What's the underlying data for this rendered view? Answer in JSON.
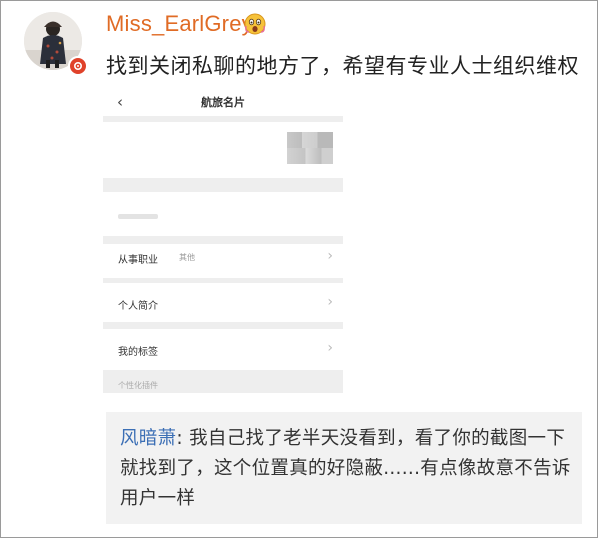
{
  "post": {
    "username": "Miss_EarlGrey",
    "text": "找到关闭私聊的地方了，希望有专业人士组织维权",
    "icons": {
      "emoji": "shocked-emoji-icon",
      "verify": "verified-badge-icon"
    },
    "colors": {
      "username": "#e06b25",
      "badge": "#e0422a"
    }
  },
  "screenshot": {
    "nav_title": "航旅名片",
    "rows": [
      {
        "label": "从事职业",
        "sub": "其他"
      },
      {
        "label": "个人简介",
        "sub": ""
      },
      {
        "label": "我的标签",
        "sub": ""
      }
    ],
    "footer_label": "个性化插件"
  },
  "comment": {
    "author": "风暗萧",
    "separator": ": ",
    "text": "我自己找了老半天没看到，看了你的截图一下就找到了，这个位置真的好隐蔽......有点像故意不告诉用户一样",
    "colors": {
      "author": "#3c6fb5"
    }
  }
}
